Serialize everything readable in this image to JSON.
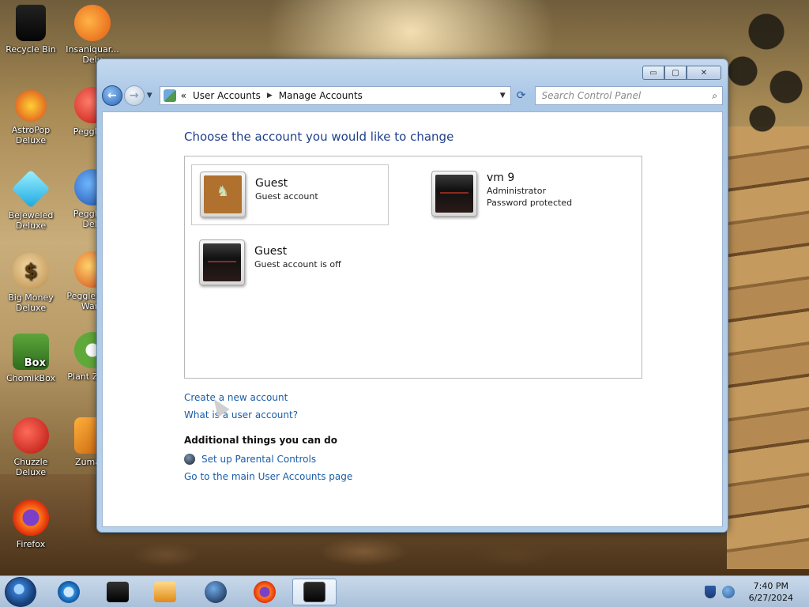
{
  "desktop": {
    "icons": [
      {
        "label": "Recycle Bin",
        "glyph": "▮"
      },
      {
        "label": "Insaniquar... Delu",
        "glyph": "🐟"
      },
      {
        "label": "AstroPop Deluxe",
        "glyph": "✶"
      },
      {
        "label": "Peggle D",
        "glyph": "P"
      },
      {
        "label": "Bejeweled Deluxe",
        "glyph": "◆"
      },
      {
        "label": "Peggle N Delu",
        "glyph": "P"
      },
      {
        "label": "Big Money Deluxe",
        "glyph": "$"
      },
      {
        "label": "Peggle W of Ward",
        "glyph": "P"
      },
      {
        "label": "ChomikBox",
        "glyph": "Box"
      },
      {
        "label": "Plant Zomb",
        "glyph": "✿"
      },
      {
        "label": "Chuzzle Deluxe",
        "glyph": "●"
      },
      {
        "label": "Zuma D",
        "glyph": "◉"
      },
      {
        "label": "Firefox",
        "glyph": "●"
      }
    ]
  },
  "window": {
    "controls": {
      "minimize": "▭",
      "maximize": "▢",
      "close": "✕"
    },
    "nav": {
      "back_icon": "←",
      "forward_icon": "→",
      "history_icon": "▼"
    },
    "address": {
      "prefix": "«",
      "crumbs": [
        "User Accounts",
        "Manage Accounts"
      ],
      "separator_icon": "▶",
      "dropdown_icon": "▼",
      "refresh_icon": "⟳"
    },
    "search": {
      "placeholder": "Search Control Panel",
      "icon": "⌕"
    },
    "title": "Choose the account you would like to change",
    "accounts": [
      {
        "name": "Guest",
        "lines": [
          "Guest account"
        ],
        "picture": "briefcase-picture",
        "selected": true
      },
      {
        "name": "vm 9",
        "lines": [
          "Administrator",
          "Password protected"
        ],
        "picture": "dark-picture",
        "selected": false
      },
      {
        "name": "Guest",
        "lines": [
          "Guest account is off"
        ],
        "picture": "dark-picture",
        "selected": false
      }
    ],
    "links": {
      "create": "Create a new account",
      "what_is": "What is a user account?"
    },
    "additional": {
      "heading": "Additional things you can do",
      "parental": "Set up Parental Controls",
      "main_page": "Go to the main User Accounts page"
    }
  },
  "taskbar": {
    "items": [
      "internet-explorer-icon",
      "black-box-icon",
      "media-player-icon",
      "globe-icon",
      "firefox-icon",
      "control-panel-icon"
    ],
    "clock": {
      "time": "7:40 PM",
      "date": "6/27/2024"
    }
  }
}
